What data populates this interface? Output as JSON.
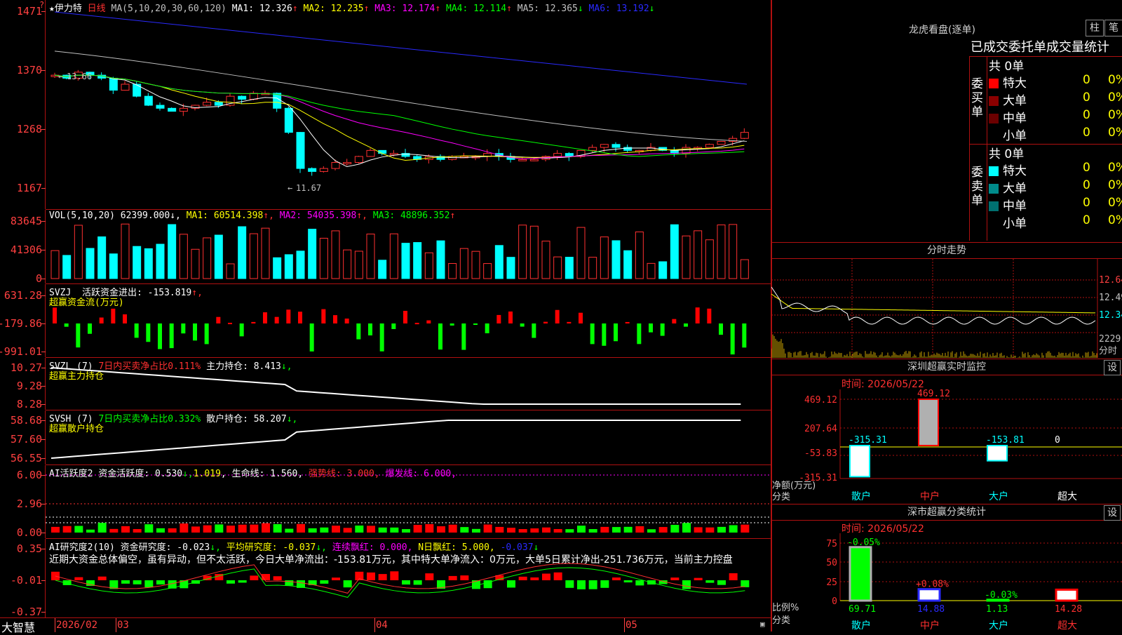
{
  "stock": {
    "star": "★",
    "name": "伊力特",
    "period": "日线",
    "ma_label": "MA(5,10,20,30,60,120)",
    "ma": [
      {
        "label": "MA1:",
        "value": "12.326",
        "arrow": "↑",
        "color": "#ffffff"
      },
      {
        "label": "MA2:",
        "value": "12.235",
        "arrow": "↑",
        "color": "#ffff00"
      },
      {
        "label": "MA3:",
        "value": "12.174",
        "arrow": "↑",
        "color": "#ff00ff"
      },
      {
        "label": "MA4:",
        "value": "12.114",
        "arrow": "↑",
        "color": "#00ff00"
      },
      {
        "label": "MA5:",
        "value": "12.365",
        "arrow": "↓",
        "color": "#c0c0c0"
      },
      {
        "label": "MA6:",
        "value": "13.192",
        "arrow": "↓",
        "color": "#2a2aff"
      }
    ],
    "high_mark": "13.66",
    "low_mark": "11.67",
    "price_axis": [
      "1471",
      "1370",
      "1268",
      "1167"
    ]
  },
  "volume": {
    "label": "VOL(5,10,20)",
    "value": "62399.000",
    "ma1": "60514.398",
    "ma2": "54035.398",
    "ma3": "48896.352",
    "axis": [
      "83645",
      "41306",
      "0"
    ]
  },
  "svzj": {
    "label": "SVZJ",
    "name": "活跃资金进出:",
    "value": "-153.819",
    "sub": "超赢资金流(万元)",
    "axis": [
      "631.28",
      "-179.86",
      "-991.01"
    ]
  },
  "svzl": {
    "label": "SVZL (7)",
    "pct": "7日内买卖净占比0.111%",
    "name": "主力持仓:",
    "value": "8.413",
    "sub": "超赢主力持仓",
    "axis": [
      "10.27",
      "9.28",
      "8.28"
    ]
  },
  "svsh": {
    "label": "SVSH (7)",
    "pct": "7日内买卖净占比0.332%",
    "name": "散户持仓:",
    "value": "58.207",
    "sub": "超赢散户持仓",
    "axis": [
      "58.68",
      "57.60",
      "56.55"
    ]
  },
  "ai1": {
    "label": "AI活跃度2",
    "name": "资金活跃度:",
    "v1": "0.530",
    "v2": "1.019",
    "life": "生命线: 1.560,",
    "strong": "强势线: 3.000,",
    "burst": "爆发线: 6.000,",
    "axis": [
      "6.00",
      "2.96",
      "0.00"
    ]
  },
  "ai2": {
    "label": "AI研究度2(10)",
    "name": "资金研究度:",
    "v1": "-0.023",
    "avg": "平均研究度: -0.037",
    "red": "连续飘红: 0.000,",
    "nred": "N日飘红: 5.000,",
    "v3": "-0.037",
    "comment": "近期大资金总体偏空，虽有异动，但不太活跃，今日大单净流出：-153.81万元，其中特大单净流入：0万元，大单5日累计净出-251.736万元，当前主力控盘",
    "axis": [
      "0.35",
      "-0.01",
      "-0.37"
    ]
  },
  "footer": {
    "brand": "大智慧",
    "dates": [
      "2026/02",
      "03",
      "04",
      "05"
    ]
  },
  "dragon": {
    "title": "龙虎看盘(逐单)",
    "btn1": "柱",
    "btn2": "笔",
    "subtitle": "已成交委托单成交量统计",
    "buy_side": "委买单",
    "sell_side": "委卖单",
    "buy_total": "共 0单",
    "sell_total": "共 0单",
    "buy_rows": [
      {
        "label": "特大",
        "qty": "0",
        "pct": "0%",
        "color": "#ff0000"
      },
      {
        "label": "大单",
        "qty": "0",
        "pct": "0%",
        "color": "#8b0000"
      },
      {
        "label": "中单",
        "qty": "0",
        "pct": "0%",
        "color": "#6b0000"
      },
      {
        "label": "小单",
        "qty": "0",
        "pct": "0%",
        "color": ""
      }
    ],
    "sell_rows": [
      {
        "label": "特大",
        "qty": "0",
        "pct": "0%",
        "color": "#00ffff"
      },
      {
        "label": "大单",
        "qty": "0",
        "pct": "0%",
        "color": "#008b8b"
      },
      {
        "label": "中单",
        "qty": "0",
        "pct": "0%",
        "color": "#007070"
      },
      {
        "label": "小单",
        "qty": "0",
        "pct": "0%",
        "color": ""
      }
    ]
  },
  "intraday": {
    "title": "分时走势",
    "axis": [
      "12.64",
      "12.49",
      "12.34",
      "2229"
    ],
    "unit": "分时"
  },
  "sz_monitor": {
    "title": "深圳超赢实时监控",
    "set": "设",
    "time": "时间: 2026/05/22",
    "axis": [
      "469.12",
      "207.64",
      "-53.83",
      "-315.31"
    ],
    "ylabel1": "净额(万元)",
    "ylabel2": "分类",
    "categories": [
      "散户",
      "中户",
      "大户",
      "超大"
    ],
    "values": [
      "-315.31",
      "469.12",
      "-153.81",
      "0"
    ]
  },
  "sz_class": {
    "title": "深市超赢分类统计",
    "set": "设",
    "time": "时间: 2026/05/22",
    "axis": [
      "75",
      "50",
      "25",
      "0"
    ],
    "ylabel1": "比例%",
    "ylabel2": "分类",
    "categories": [
      "散户",
      "中户",
      "大户",
      "超大"
    ],
    "values": [
      "69.71",
      "14.88",
      "1.13",
      "14.28"
    ],
    "deltas": [
      "-0.05%",
      "+0.08%",
      "-0.03%",
      ""
    ]
  },
  "chart_data": {
    "type": "bar",
    "title": "深市超赢分类统计",
    "categories": [
      "散户",
      "中户",
      "大户",
      "超大"
    ],
    "series": [
      {
        "name": "净额(万元)",
        "values": [
          -315.31,
          469.12,
          -153.81,
          0
        ]
      },
      {
        "name": "比例%",
        "values": [
          69.71,
          14.88,
          1.13,
          14.28
        ]
      }
    ],
    "colors": {
      "up": "#ff0000",
      "down": "#00ffff",
      "flat": "#ffffff"
    }
  }
}
